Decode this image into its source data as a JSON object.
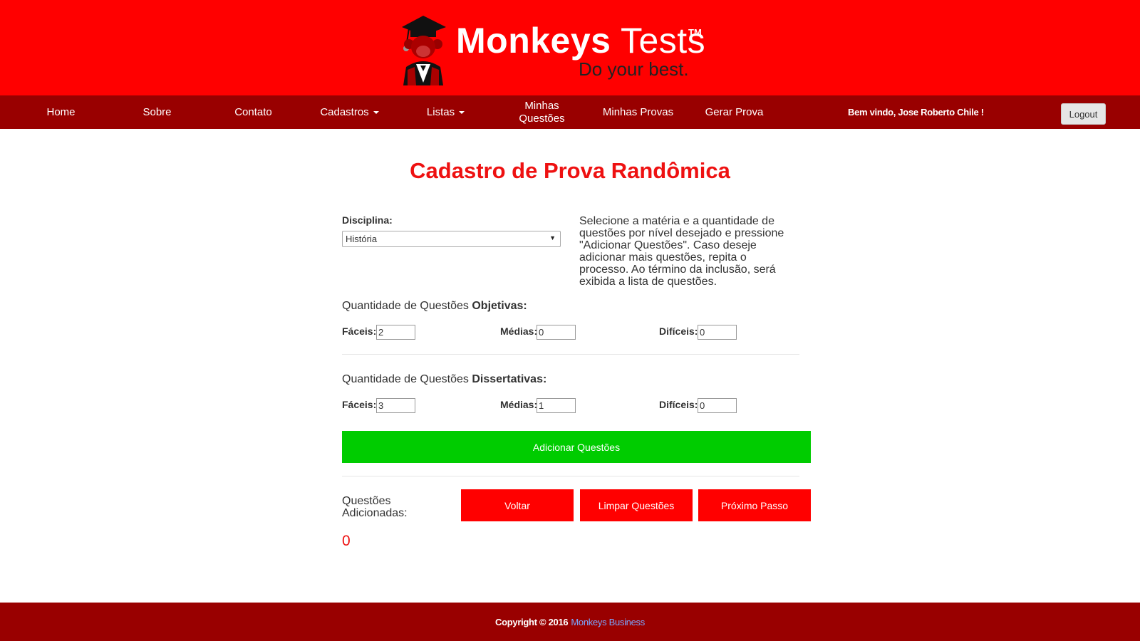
{
  "brand": {
    "name_bold": "Monkeys",
    "name_light": "Tests",
    "trademark": "TM",
    "tagline": "Do your best."
  },
  "nav": {
    "home": "Home",
    "sobre": "Sobre",
    "contato": "Contato",
    "cadastros": "Cadastros",
    "listas": "Listas",
    "minhas_questoes_1": "Minhas",
    "minhas_questoes_2": "Questões",
    "minhas_provas": "Minhas Provas",
    "gerar_prova": "Gerar Prova",
    "welcome": "Bem vindo, Jose Roberto Chile !",
    "logout": "Logout"
  },
  "main": {
    "title": "Cadastro de Prova Randômica",
    "disciplina_label": "Disciplina:",
    "disciplina_value": "História",
    "help_text": "Selecione a matéria e a quantidade de questões por nível desejado e pressione \"Adicionar Questões\". Caso deseje adicionar mais questões, repita o processo. Ao término da inclusão, será exibida a lista de questões.",
    "objetivas": {
      "title_prefix": "Quantidade de Questões ",
      "title_bold": "Objetivas:",
      "faceis_label": "Fáceis:",
      "faceis_value": "2",
      "medias_label": "Médias:",
      "medias_value": "0",
      "dificeis_label": "Difíceis:",
      "dificeis_value": "0"
    },
    "dissertativas": {
      "title_prefix": "Quantidade de Questões ",
      "title_bold": "Dissertativas:",
      "faceis_label": "Fáceis:",
      "faceis_value": "3",
      "medias_label": "Médias:",
      "medias_value": "1",
      "dificeis_label": "Difíceis:",
      "dificeis_value": "0"
    },
    "add_button": "Adicionar Questões",
    "added_label": "Questões Adicionadas:",
    "added_count": "0",
    "voltar": "Voltar",
    "limpar": "Limpar Questões",
    "proximo": "Próximo Passo"
  },
  "footer": {
    "copyright": "Copyright © 2016",
    "link": "Monkeys Business"
  },
  "colors": {
    "header_red": "#ff0000",
    "nav_dark_red": "#990000",
    "title_red": "#ee1111",
    "add_green": "#00cc00"
  }
}
